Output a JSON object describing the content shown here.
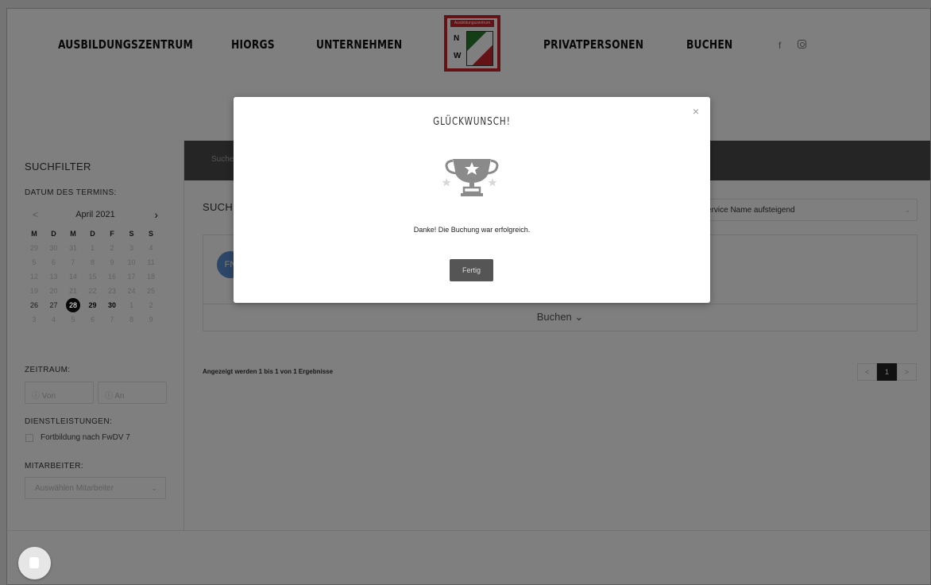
{
  "nav": {
    "items": [
      "AUSBILDUNGSZENTRUM",
      "HIORGS",
      "UNTERNEHMEN",
      "PRIVATPERSONEN",
      "BUCHEN"
    ],
    "logo_text": "Ausbildungszentrum",
    "logo_letters": [
      "N",
      "W"
    ],
    "social": [
      "f"
    ]
  },
  "sidebar": {
    "title": "SUCHFILTER",
    "date_label": "DATUM DES TERMINS:",
    "calendar": {
      "month": "April 2021",
      "prev": "<",
      "next": "›",
      "weekdays": [
        "M",
        "D",
        "M",
        "D",
        "F",
        "S",
        "S"
      ],
      "weeks": [
        [
          "29",
          "30",
          "31",
          "1",
          "2",
          "3",
          "4"
        ],
        [
          "5",
          "6",
          "7",
          "8",
          "9",
          "10",
          "11"
        ],
        [
          "12",
          "13",
          "14",
          "15",
          "16",
          "17",
          "18"
        ],
        [
          "19",
          "20",
          "21",
          "22",
          "23",
          "24",
          "25"
        ],
        [
          "26",
          "27",
          "28",
          "29",
          "30",
          "1",
          "2"
        ],
        [
          "3",
          "4",
          "5",
          "6",
          "7",
          "8",
          "9"
        ]
      ],
      "selected": "28"
    },
    "zeitraum_label": "ZEITRAUM:",
    "von_placeholder": "ⓘ Von",
    "an_placeholder": "ⓘ An",
    "services_label": "DIENSTLEISTUNGEN:",
    "service_option": "Fortbildung nach FwDV 7",
    "staff_label": "MITARBEITER:",
    "staff_placeholder": "Auswählen Mitarbeiter"
  },
  "main": {
    "banner_text": "Suche",
    "title": "SUCHE",
    "sort_value": "ervice Name aufsteigend",
    "avatar": "FN",
    "book_label": "Buchen",
    "results_text": "Angezeigt werden 1 bis 1 von 1 Ergebnisse",
    "pager": [
      "<",
      "1",
      ">"
    ]
  },
  "modal": {
    "title": "GLÜCKWUNSCH!",
    "message": "Danke! Die Buchung war erfolgreich.",
    "button": "Fertig",
    "close": "×",
    "icon": "trophy-icon"
  }
}
